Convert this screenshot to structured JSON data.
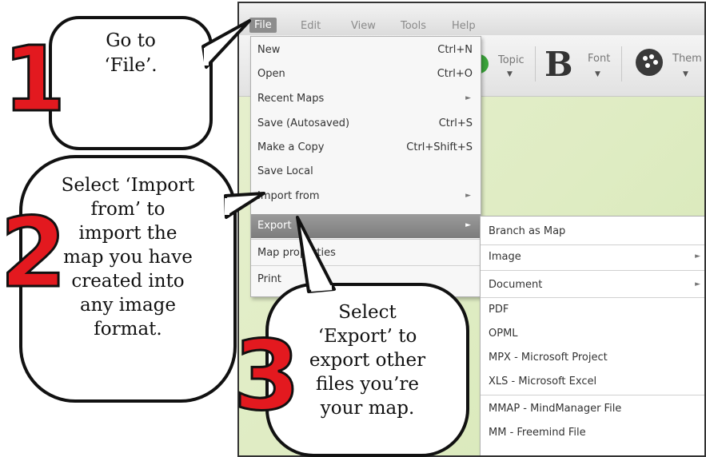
{
  "app": {
    "menubar": [
      "File",
      "Edit",
      "View",
      "Tools",
      "Help"
    ],
    "toolbar": {
      "topic_label": "Topic",
      "font_label": "Font",
      "bold_label": "B",
      "theme_label": "Them"
    }
  },
  "file_menu": {
    "items": [
      {
        "label": "New",
        "shortcut": "Ctrl+N",
        "submenu": false
      },
      {
        "label": "Open",
        "shortcut": "Ctrl+O",
        "submenu": false
      },
      {
        "label": "Recent Maps",
        "shortcut": "",
        "submenu": true
      },
      {
        "label": "Save (Autosaved)",
        "shortcut": "Ctrl+S",
        "submenu": false
      },
      {
        "label": "Make a Copy",
        "shortcut": "Ctrl+Shift+S",
        "submenu": false
      },
      {
        "label": "Save Local",
        "shortcut": "",
        "submenu": false
      },
      {
        "label": "Import from",
        "shortcut": "",
        "submenu": true
      },
      {
        "label": "Export",
        "shortcut": "",
        "submenu": true,
        "highlighted": true
      },
      {
        "label": "Map properties",
        "shortcut": "",
        "submenu": false
      },
      {
        "label": "Print",
        "shortcut": "",
        "submenu": false
      }
    ]
  },
  "export_menu": {
    "items": [
      {
        "label": "Branch as Map",
        "submenu": false
      },
      {
        "label": "Image",
        "submenu": true
      },
      {
        "label": "Document",
        "submenu": true
      },
      {
        "label": "PDF",
        "submenu": false
      },
      {
        "label": "OPML",
        "submenu": false
      },
      {
        "label": "MPX - Microsoft Project",
        "submenu": false
      },
      {
        "label": "XLS - Microsoft Excel",
        "submenu": false
      },
      {
        "label": "MMAP - MindManager File",
        "submenu": false
      },
      {
        "label": "MM - Freemind File",
        "submenu": false
      }
    ]
  },
  "callouts": {
    "step1": {
      "number": "1",
      "lines": [
        "Go to",
        "‘File’."
      ]
    },
    "step2": {
      "number": "2",
      "lines": [
        "Select ‘Import",
        "from’ to",
        "import the",
        "map you have",
        "created into",
        "any image",
        "format."
      ]
    },
    "step3": {
      "number": "3",
      "lines": [
        "Select",
        "‘Export’ to",
        "export other",
        "files you’re",
        "your map."
      ]
    }
  },
  "colors": {
    "step_number": "#e3191f",
    "menu_highlight": "#8d8d8d",
    "canvas": "#e3eecb",
    "accent_teal": "#2f6f61"
  }
}
